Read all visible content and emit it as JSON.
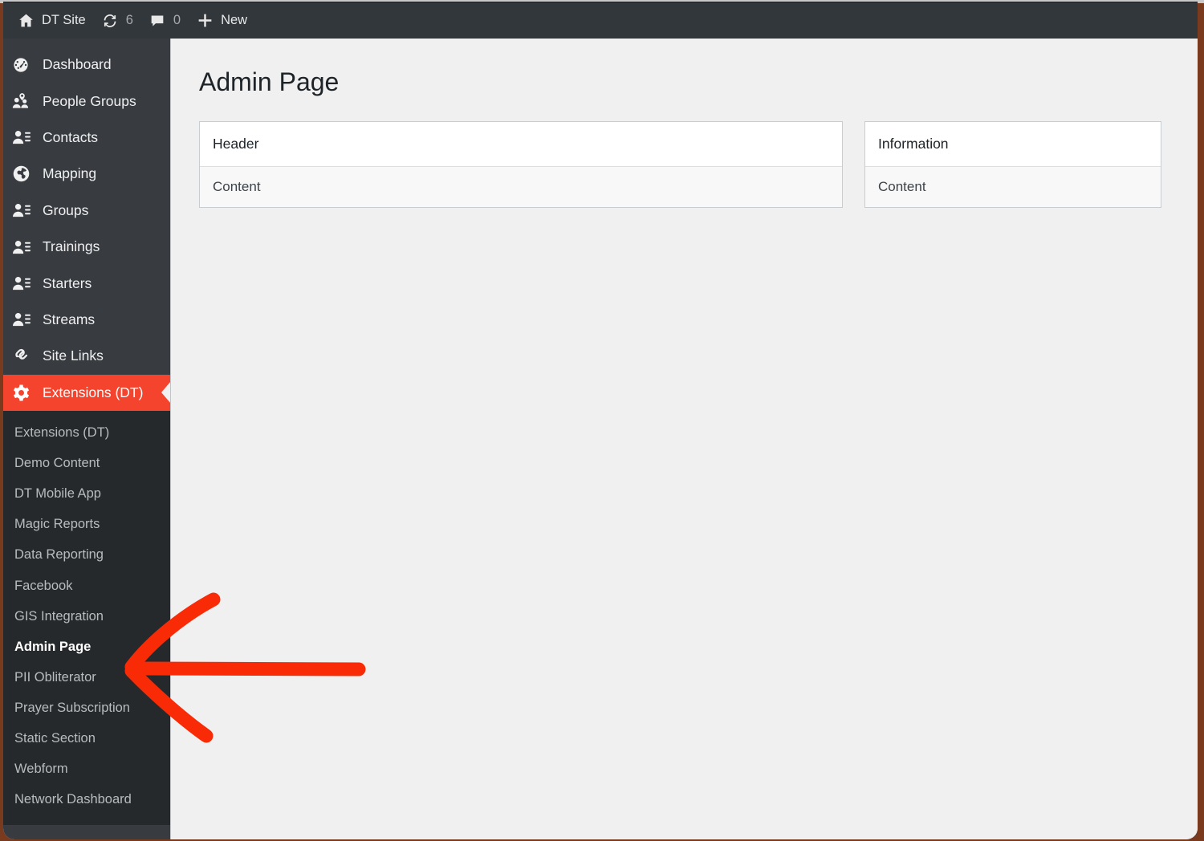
{
  "adminbar": {
    "site": {
      "icon": "home-icon",
      "label": "DT Site"
    },
    "updates": {
      "icon": "updates-sync-icon",
      "count": "6"
    },
    "comments": {
      "icon": "comment-bubble-icon",
      "count": "0"
    },
    "new": {
      "icon": "plus-icon",
      "label": "New"
    }
  },
  "sidebar": {
    "items": [
      {
        "label": "Dashboard",
        "icon": "dashboard-gauge-icon",
        "current": false
      },
      {
        "label": "People Groups",
        "icon": "people-group-pin-icon",
        "current": false
      },
      {
        "label": "Contacts",
        "icon": "person-list-icon",
        "current": false
      },
      {
        "label": "Mapping",
        "icon": "globe-icon",
        "current": false
      },
      {
        "label": "Groups",
        "icon": "person-list-icon",
        "current": false
      },
      {
        "label": "Trainings",
        "icon": "person-list-icon",
        "current": false
      },
      {
        "label": "Starters",
        "icon": "person-list-icon",
        "current": false
      },
      {
        "label": "Streams",
        "icon": "person-list-icon",
        "current": false
      },
      {
        "label": "Site Links",
        "icon": "link-chain-icon",
        "current": false
      },
      {
        "label": "Extensions (DT)",
        "icon": "gear-icon",
        "current": true
      }
    ],
    "submenu": [
      {
        "label": "Extensions (DT)",
        "current": false
      },
      {
        "label": "Demo Content",
        "current": false
      },
      {
        "label": "DT Mobile App",
        "current": false
      },
      {
        "label": "Magic Reports",
        "current": false
      },
      {
        "label": "Data Reporting",
        "current": false
      },
      {
        "label": "Facebook",
        "current": false
      },
      {
        "label": "GIS Integration",
        "current": false
      },
      {
        "label": "Admin Page",
        "current": true
      },
      {
        "label": "PII Obliterator",
        "current": false
      },
      {
        "label": "Prayer Subscription",
        "current": false
      },
      {
        "label": "Static Section",
        "current": false
      },
      {
        "label": "Webform",
        "current": false
      },
      {
        "label": "Network Dashboard",
        "current": false
      }
    ]
  },
  "main": {
    "page_title": "Admin Page",
    "cards": [
      {
        "header": "Header",
        "body": "Content"
      },
      {
        "header": "Information",
        "body": "Content"
      }
    ]
  },
  "annotation": {
    "shape": "red-left-arrow",
    "color": "#f92b07",
    "points_at": "Admin Page"
  },
  "colors": {
    "accent_red": "#f4442e",
    "sidebar_bg": "#383c41",
    "submenu_bg": "#26292c",
    "adminbar_bg": "#32373c",
    "content_bg": "#f0f0f1",
    "annotation_red": "#f92b07"
  }
}
